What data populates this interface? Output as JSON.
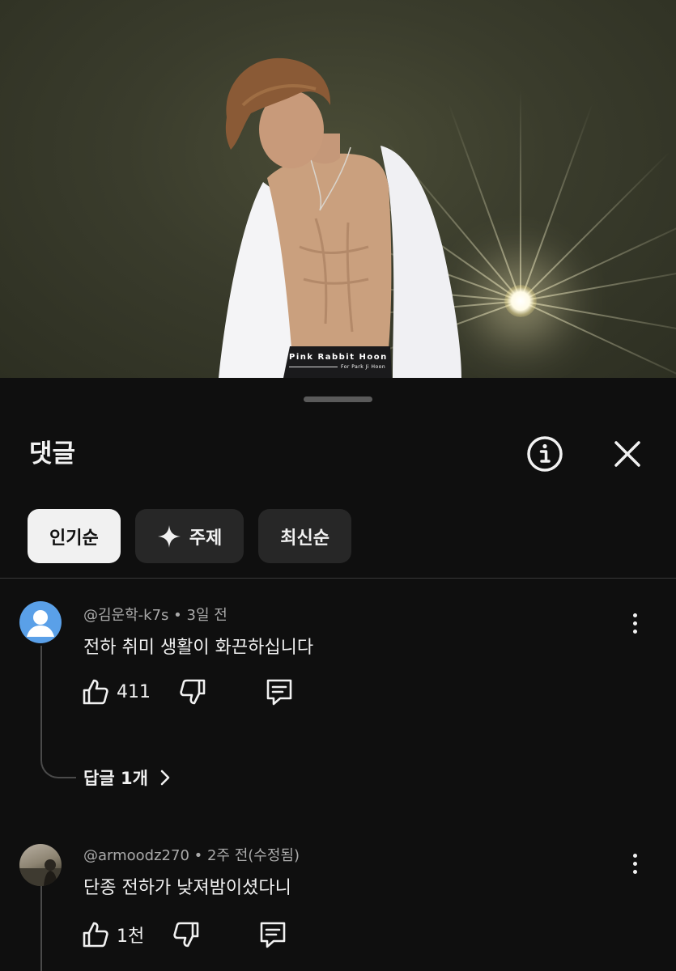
{
  "video": {
    "overlay_title": "Pink Rabbit Hoon",
    "overlay_subtitle": "For Park Ji Hoon"
  },
  "sheet": {
    "title": "댓글",
    "info_icon": "info-icon",
    "close_icon": "close-icon"
  },
  "chips": [
    {
      "label": "인기순",
      "active": true
    },
    {
      "label": "주제",
      "icon": "sparkle-icon",
      "active": false
    },
    {
      "label": "최신순",
      "active": false
    }
  ],
  "comments": [
    {
      "author": "@김운학-k7s",
      "time": "3일 전",
      "text": "전하 취미 생활이 화끈하십니다",
      "likes": "411",
      "replies_label": "답글 1개"
    },
    {
      "author": "@armoodz270",
      "time": "2주 전(수정됨)",
      "text": "단종 전하가 낮져밤이셨다니",
      "likes": "1천"
    }
  ],
  "colors": {
    "background": "#0f0f0f",
    "chip": "#272727",
    "chip_active": "#f1f1f1",
    "secondary_text": "#aaaaaa",
    "default_avatar": "#5aa0e8"
  }
}
